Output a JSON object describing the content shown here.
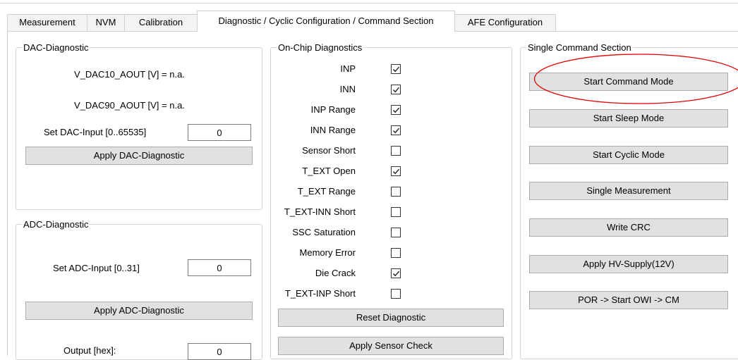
{
  "tabs": [
    {
      "label": "Measurement"
    },
    {
      "label": "NVM"
    },
    {
      "label": "Calibration"
    },
    {
      "label": "Diagnostic / Cyclic Configuration / Command Section"
    },
    {
      "label": "AFE Configuration"
    }
  ],
  "active_tab": "Diagnostic / Cyclic Configuration / Command Section",
  "dac": {
    "title": "DAC-Diagnostic",
    "v10": "V_DAC10_AOUT [V] = n.a.",
    "v90": "V_DAC90_AOUT [V] = n.a.",
    "input_label": "Set DAC-Input [0..65535]",
    "input_value": "0",
    "apply_label": "Apply DAC-Diagnostic"
  },
  "adc": {
    "title": "ADC-Diagnostic",
    "input_label": "Set ADC-Input [0..31]",
    "input_value": "0",
    "apply_label": "Apply ADC-Diagnostic",
    "output_label": "Output [hex]:",
    "output_value": "0"
  },
  "onchip": {
    "title": "On-Chip Diagnostics",
    "items": [
      {
        "label": "INP",
        "checked": true
      },
      {
        "label": "INN",
        "checked": true
      },
      {
        "label": "INP Range",
        "checked": true
      },
      {
        "label": "INN Range",
        "checked": true
      },
      {
        "label": "Sensor Short",
        "checked": false
      },
      {
        "label": "T_EXT Open",
        "checked": true
      },
      {
        "label": "T_EXT Range",
        "checked": false
      },
      {
        "label": "T_EXT-INN Short",
        "checked": false
      },
      {
        "label": "SSC Saturation",
        "checked": false
      },
      {
        "label": "Memory Error",
        "checked": false
      },
      {
        "label": "Die Crack",
        "checked": true
      },
      {
        "label": "T_EXT-INP Short",
        "checked": false
      }
    ],
    "reset_label": "Reset Diagnostic",
    "apply_label": "Apply Sensor Check"
  },
  "single": {
    "title": "Single Command Section",
    "buttons": [
      {
        "label": "Start Command Mode"
      },
      {
        "label": "Start Sleep Mode"
      },
      {
        "label": "Start Cyclic Mode"
      },
      {
        "label": "Single Measurement"
      },
      {
        "label": "Write CRC"
      },
      {
        "label": "Apply HV-Supply(12V)"
      },
      {
        "label": "POR -> Start OWI -> CM"
      }
    ]
  },
  "colors": {
    "highlight_ellipse": "#e00000",
    "button_face": "#e1e1e1"
  }
}
